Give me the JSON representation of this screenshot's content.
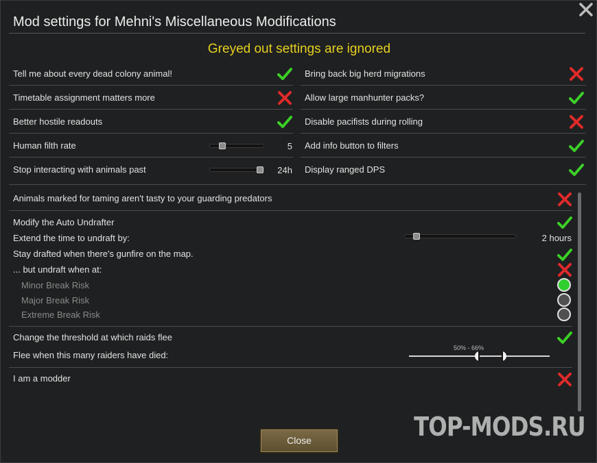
{
  "window": {
    "title": "Mod settings for Mehni's Miscellaneous Modifications",
    "subtitle": "Greyed out settings are ignored"
  },
  "left_settings": [
    {
      "label": "Tell me about every dead colony animal!",
      "type": "check",
      "state": "on"
    },
    {
      "label": "Timetable assignment matters more",
      "type": "check",
      "state": "off"
    },
    {
      "label": "Better hostile readouts",
      "type": "check",
      "state": "on"
    },
    {
      "label": "Human filth rate",
      "type": "slider",
      "value": "5",
      "fraction": 0.18
    },
    {
      "label": "Stop interacting with animals past",
      "type": "slider",
      "value": "24h",
      "fraction": 0.95
    }
  ],
  "right_settings": [
    {
      "label": "Bring back big herd migrations",
      "state": "off"
    },
    {
      "label": "Allow large manhunter packs?",
      "state": "on"
    },
    {
      "label": "Disable pacifists during rolling",
      "state": "off"
    },
    {
      "label": "Add info button to filters",
      "state": "on"
    },
    {
      "label": "Display ranged DPS",
      "state": "on"
    }
  ],
  "lower": {
    "animals_taming": {
      "label": "Animals marked for taming aren't tasty to your guarding predators",
      "state": "off"
    },
    "auto_undrafter": {
      "label": "Modify the Auto Undrafter",
      "state": "on"
    },
    "extend_time": {
      "label": "Extend the time to undraft by:",
      "value": "2 hours",
      "fraction": 0.05
    },
    "stay_drafted": {
      "label": "Stay drafted when there's gunfire on the map.",
      "state": "on"
    },
    "undraft_when": {
      "label": "... but undraft when at:",
      "state": "off"
    },
    "break_risks": [
      {
        "label": "Minor Break Risk",
        "selected": true
      },
      {
        "label": "Major Break Risk",
        "selected": false
      },
      {
        "label": "Extreme Break Risk",
        "selected": false
      }
    ],
    "raid_threshold": {
      "label": "Change the threshold at which raids flee",
      "state": "on"
    },
    "flee_when": {
      "label": "Flee when this many raiders have died:",
      "range_label": "50% - 66%",
      "low": 0.5,
      "high": 0.66
    },
    "modder": {
      "label": "I am a modder",
      "state": "off"
    }
  },
  "buttons": {
    "close": "Close"
  },
  "watermark": "TOP-MODS.RU",
  "colors": {
    "check_on": "#3ccf28",
    "check_off": "#e02a2a",
    "accent": "#e6d020"
  }
}
